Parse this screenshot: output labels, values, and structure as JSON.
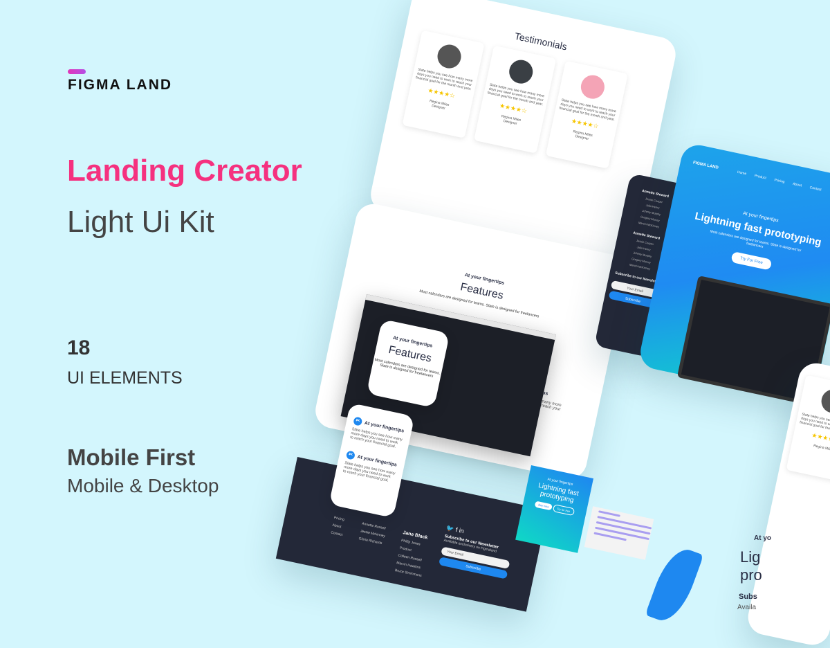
{
  "brand": {
    "logo": "FIGMA LAND"
  },
  "hero_text": {
    "title": "Landing Creator",
    "subtitle": "Light Ui Kit",
    "count": "18",
    "count_label": "UI ELEMENTS",
    "feature": "Mobile First",
    "feature_sub": "Mobile & Desktop"
  },
  "colors": {
    "background": "#d3f6fd",
    "accent_pink": "#f5317f",
    "accent_blue": "#1e88f0",
    "dark": "#232838"
  },
  "testimonials": {
    "title": "Testimonials",
    "quote": "Slate helps you see how many more days you need to work to reach your financial goal for the month and year.",
    "name": "Regina Miles",
    "role": "Designer",
    "rating": "4 of 5"
  },
  "features": {
    "eyebrow": "At your fingertips",
    "title": "Features",
    "desc": "Most calendars are designed for teams. Slate is designed for freelancers",
    "item_title": "At your fingertips",
    "item_text": "Slate helps you see how many more days you need to work to reach your financial goal."
  },
  "hero": {
    "nav": [
      "Home",
      "Product",
      "Pricing",
      "About",
      "Contact"
    ],
    "eyebrow": "At your fingertips",
    "title": "Lightning fast prototyping",
    "desc": "Most calendars are designed for teams. Slate is designed for freelancers",
    "cta": "Try For Free"
  },
  "footer": {
    "col1": [
      "Pricing",
      "About",
      "Contact"
    ],
    "col2": [
      "Annette Russell",
      "Jessie Mckinney",
      "Gloria Richards"
    ],
    "col3_title": "Jane Black",
    "col3": [
      "Phillip Jones",
      "Product",
      "Colleen Russell",
      "Marvin Hawkins",
      "Bruce Simmmons"
    ],
    "newsletter_title": "Subscribe to our Newsletter",
    "newsletter_sub": "Available exclusivery on Figmaland",
    "email_placeholder": "Your Email",
    "subscribe": "Subscribe"
  },
  "mobile_footer": {
    "groups": [
      {
        "title": "Annette Steward",
        "items": [
          "Jessie Cooper",
          "Julia Henry",
          "Johnny Murphy",
          "Gregory Murray",
          "Marvin McKinney"
        ]
      },
      {
        "title": "Annette Steward",
        "items": [
          "Jessie Cooper",
          "Julia Henry",
          "Johnny Murphy",
          "Gregory Murray",
          "Marvin McKinney"
        ]
      }
    ]
  },
  "promo_card": {
    "eyebrow": "At your fingertips",
    "title": "Lightning fast prototyping",
    "primary": "Buy now",
    "secondary": "Try for free"
  },
  "lower_right": {
    "eyebrow": "At yo",
    "title": "Lig pro",
    "sub": "Subs",
    "sub2": "Availa"
  }
}
